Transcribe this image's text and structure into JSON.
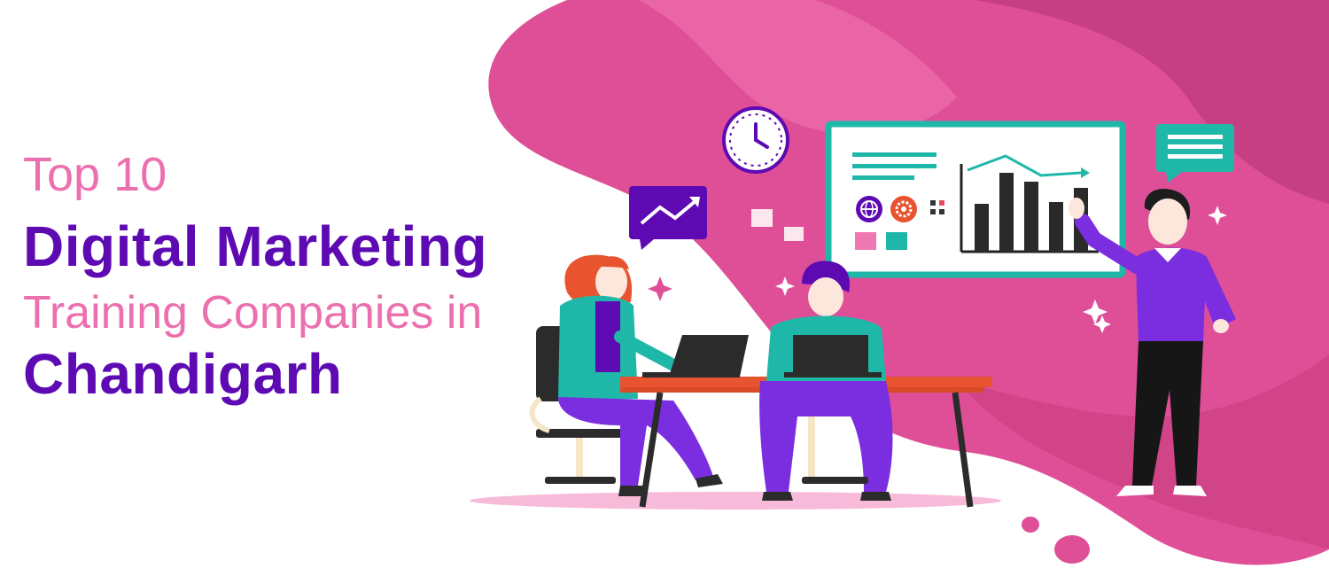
{
  "banner": {
    "line1": "Top 10",
    "line2": "Digital Marketing",
    "line3": "Training Companies in",
    "line4": "Chandigarh"
  },
  "colors": {
    "accent_pink": "#ec6fae",
    "accent_purple": "#5d0ab3",
    "blob_pink": "#df4f97",
    "blob_dark_pink": "#c23c7e",
    "teal": "#20b8a8"
  },
  "illustration": {
    "scene": "office-team-meeting",
    "icons": [
      "clock-icon",
      "trend-chat-icon",
      "message-chat-icon",
      "globe-icon",
      "gear-icon",
      "bar-chart-icon",
      "sparkle-icon"
    ]
  }
}
